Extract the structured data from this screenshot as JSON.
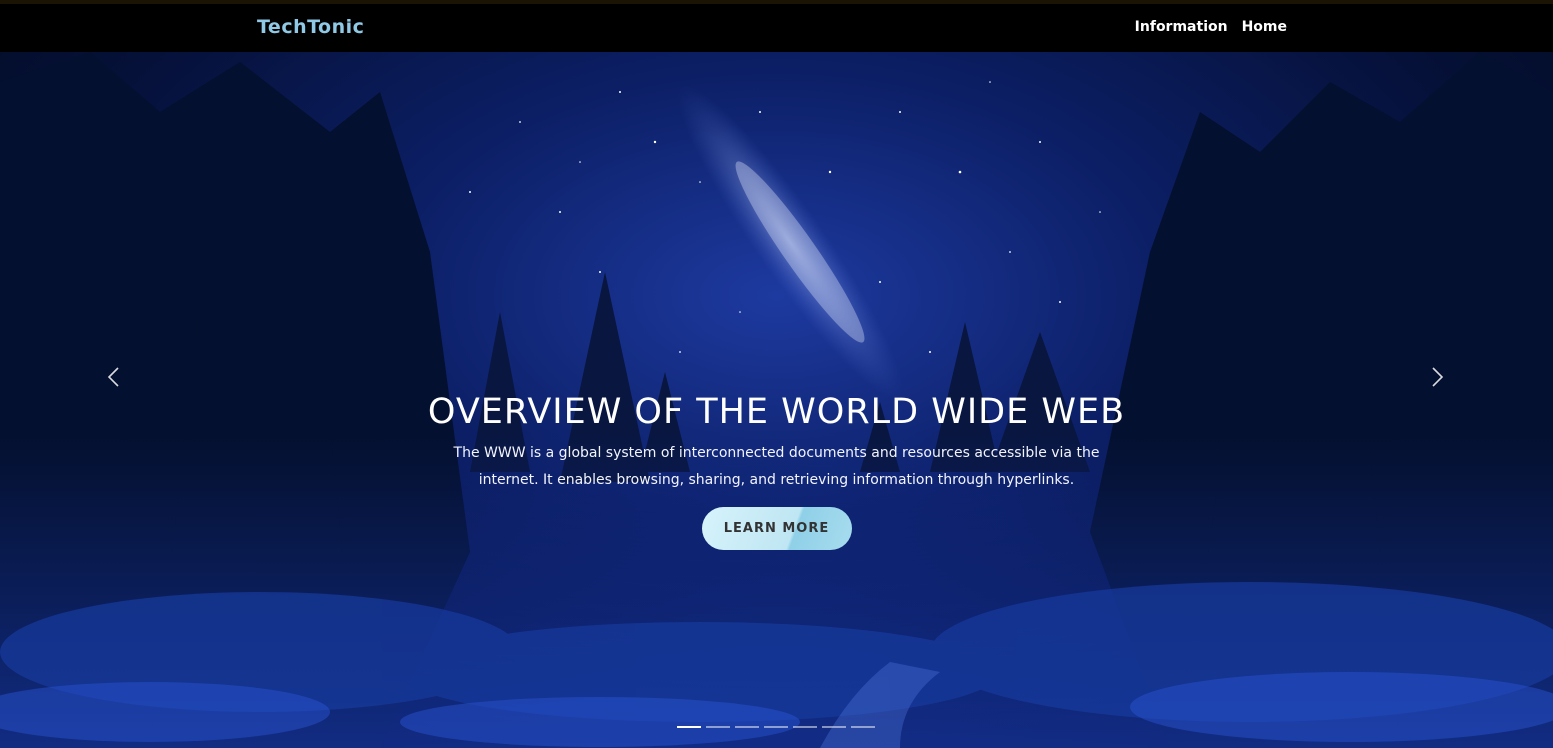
{
  "navbar": {
    "brand": "TechTonic",
    "links": [
      {
        "label": "Information"
      },
      {
        "label": "Home"
      }
    ]
  },
  "hero": {
    "title": "OVERVIEW OF THE WORLD WIDE WEB",
    "description": "The WWW is a global system of interconnected documents and resources accessible via the internet. It enables browsing, sharing, and retrieving information through hyperlinks.",
    "button_label": "LEARN MORE",
    "prev_icon": "chevron-left-icon",
    "next_icon": "chevron-right-icon",
    "slide_count": 7,
    "active_slide": 1
  },
  "colors": {
    "brand": "#8fc9e6",
    "nav_bg": "#000000",
    "button_bg": "#c9edf7",
    "sky": "#0c1f66"
  }
}
